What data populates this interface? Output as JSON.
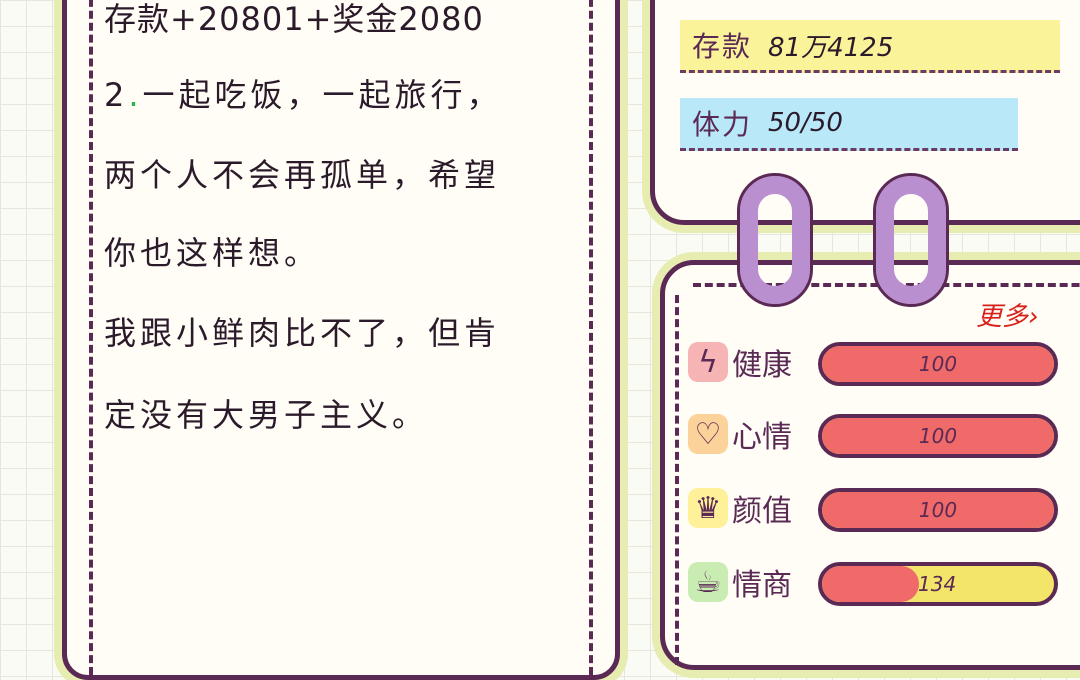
{
  "note": {
    "lines": [
      "存款+20801+奖金2080",
      "2",
      "一起吃饭，一起旅行，",
      "两个人不会再孤单，希望",
      "你也这样想。",
      "我跟小鲜肉比不了，但肯",
      "定没有大男子主义。"
    ]
  },
  "stats": {
    "savings_label": "存款",
    "savings_value": "81万4125",
    "stamina_label": "体力",
    "stamina_value": "50/50"
  },
  "attributes": {
    "more_label": "更多",
    "items": [
      {
        "label": "健康",
        "value": "100",
        "fraction": 1.0,
        "icon": "lightning-icon"
      },
      {
        "label": "心情",
        "value": "100",
        "fraction": 1.0,
        "icon": "heart-icon"
      },
      {
        "label": "颜值",
        "value": "100",
        "fraction": 1.0,
        "icon": "crown-icon"
      },
      {
        "label": "情商",
        "value": "134",
        "fraction": 0.42,
        "icon": "cup-icon"
      }
    ]
  },
  "colors": {
    "border": "#5a2a55",
    "bar_fill": "#f06a6a",
    "bar_track": "#f3e46a",
    "savings_highlight": "#faf39a",
    "stamina_highlight": "#b9e8f8",
    "more_text": "#d8201a"
  }
}
